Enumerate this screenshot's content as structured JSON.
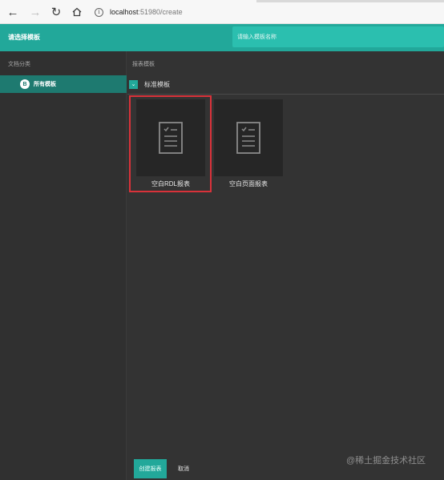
{
  "browser": {
    "url_host": "localhost",
    "url_path": ":51980/create"
  },
  "header": {
    "title": "请选择模板",
    "search_placeholder": "请输入模板名称"
  },
  "sidebar": {
    "label": "文档分类",
    "items": [
      {
        "badge": "B",
        "label": "所有模板"
      }
    ]
  },
  "main": {
    "label": "报表模板",
    "section_title": "标准模板",
    "templates": [
      {
        "label": "空白RDL报表",
        "selected": true
      },
      {
        "label": "空白页面报表",
        "selected": false
      }
    ]
  },
  "footer": {
    "create_label": "创建报表",
    "cancel_label": "取消"
  },
  "watermark": "@稀土掘金技术社区",
  "colors": {
    "accent": "#22a89a",
    "accent_dark": "#1e7a70",
    "background": "#333333",
    "selection": "#d9323a"
  }
}
